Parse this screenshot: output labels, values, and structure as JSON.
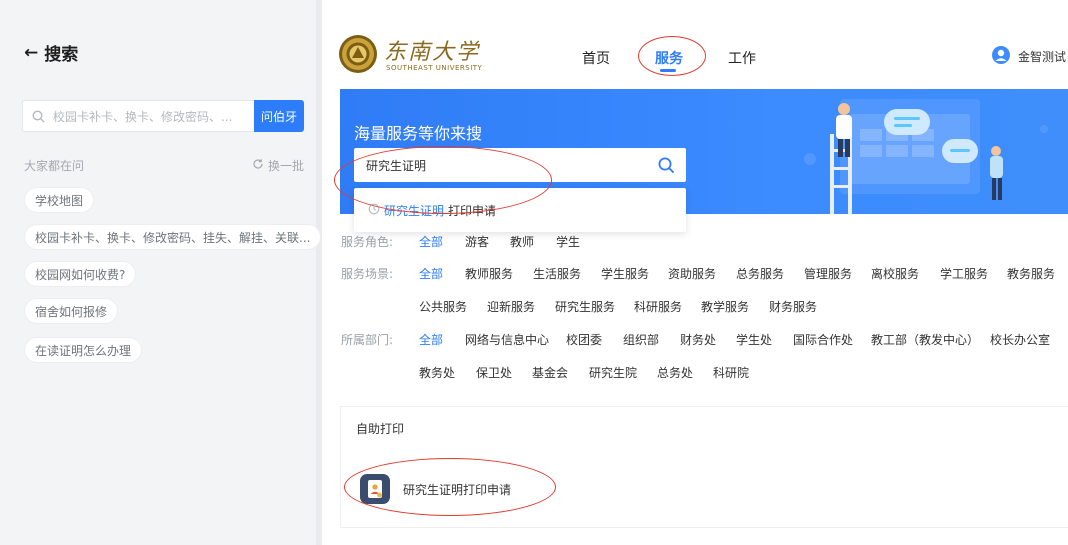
{
  "left_panel": {
    "title": "搜索",
    "search_placeholder": "校园卡补卡、换卡、修改密码、...",
    "ask_button": "问伯牙",
    "popular_label": "大家都在问",
    "refresh_label": "换一批",
    "questions": [
      "学校地图",
      "校园卡补卡、换卡、修改密码、挂失、解挂、关联...",
      "校园网如何收费?",
      "宿舍如何报修",
      "在读证明怎么办理"
    ]
  },
  "header": {
    "logo_cn": "东南大学",
    "logo_en": "SOUTHEAST UNIVERSITY",
    "nav": [
      "首页",
      "服务",
      "工作"
    ],
    "active_nav": "服务",
    "user_name": "金智测试"
  },
  "banner": {
    "title": "海量服务等你来搜",
    "search_value": "研究生证明",
    "suggestion_highlight": "研究生证明",
    "suggestion_rest": "打印申请"
  },
  "filters": {
    "role_label": "服务角色:",
    "roles": [
      "全部",
      "游客",
      "教师",
      "学生"
    ],
    "scene_label": "服务场景:",
    "scenes_row1": [
      "全部",
      "教师服务",
      "生活服务",
      "学生服务",
      "资助服务",
      "总务服务",
      "管理服务",
      "离校服务",
      "学工服务",
      "教务服务"
    ],
    "scenes_row2": [
      "公共服务",
      "迎新服务",
      "研究生服务",
      "科研服务",
      "教学服务",
      "财务服务"
    ],
    "dept_label": "所属部门:",
    "depts_row1": [
      "全部",
      "网络与信息中心",
      "校团委",
      "组织部",
      "财务处",
      "学生处",
      "国际合作处",
      "教工部（教发中心）",
      "校长办公室"
    ],
    "depts_row2": [
      "教务处",
      "保卫处",
      "基金会",
      "研究生院",
      "总务处",
      "科研院"
    ]
  },
  "results": {
    "category": "自助打印",
    "service_label": "研究生证明打印申请"
  },
  "colors": {
    "accent": "#2d7dfa",
    "annotation_red": "#e33a2f"
  }
}
